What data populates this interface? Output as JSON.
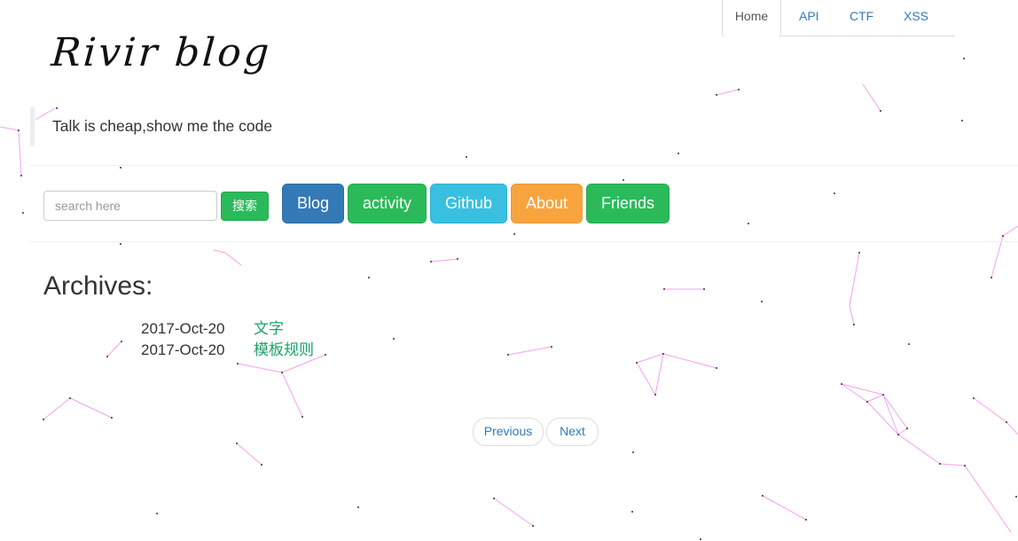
{
  "nav": {
    "tabs": [
      {
        "label": "Home"
      },
      {
        "label": "API"
      },
      {
        "label": "CTF"
      },
      {
        "label": "XSS"
      }
    ]
  },
  "header": {
    "logo": "Rivir blog",
    "motto": "Talk is cheap,show me the code"
  },
  "search": {
    "placeholder": "search here",
    "button": "搜索"
  },
  "menu": {
    "blog": "Blog",
    "activity": "activity",
    "github": "Github",
    "about": "About",
    "friends": "Friends"
  },
  "colors": {
    "primary": "#337ab7",
    "success": "#2bba5a",
    "info": "#39c0e0",
    "warning": "#f7a43f",
    "link_green": "#1aa36a",
    "particle_line": "#ee66dd"
  },
  "archives": {
    "title": "Archives:",
    "items": [
      {
        "date": "2017-Oct-20",
        "title": "文字"
      },
      {
        "date": "2017-Oct-20",
        "title": "模板规则"
      }
    ]
  },
  "pager": {
    "previous": "Previous",
    "next": "Next"
  }
}
